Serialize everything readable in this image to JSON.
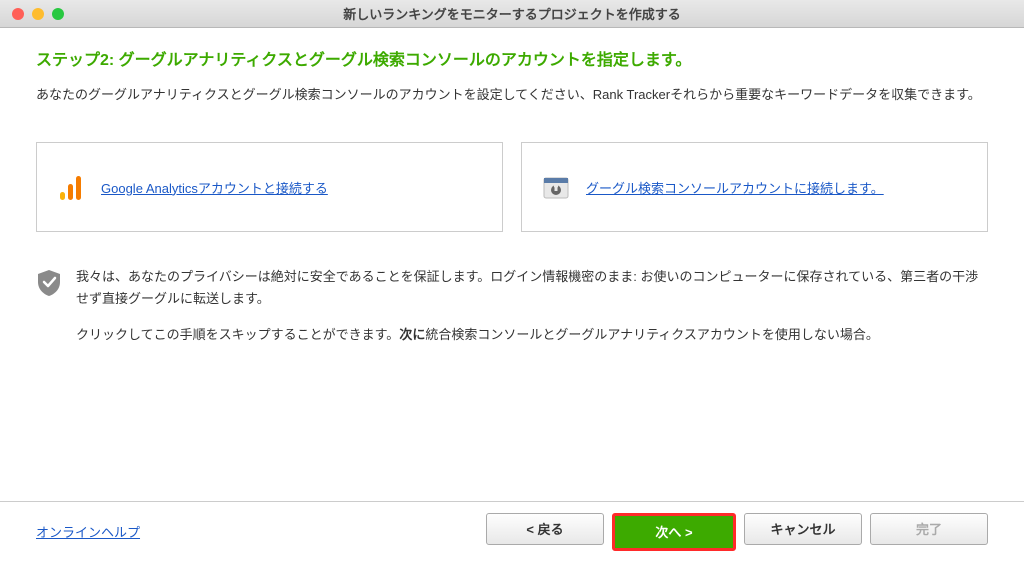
{
  "window": {
    "title": "新しいランキングをモニターするプロジェクトを作成する"
  },
  "step": {
    "heading": "ステップ2: グーグルアナリティクスとグーグル検索コンソールのアカウントを指定します。",
    "description": "あなたのグーグルアナリティクスとグーグル検索コンソールのアカウントを設定してください、Rank Trackerそれらから重要なキーワードデータを収集できます。"
  },
  "cards": {
    "analytics": {
      "label": "Google Analyticsアカウントと接続する"
    },
    "search_console": {
      "label": "グーグル検索コンソールアカウントに接続します。"
    }
  },
  "privacy": {
    "line1": "我々は、あなたのプライバシーは絶対に安全であることを保証します。ログイン情報機密のまま: お使いのコンピューターに保存されている、第三者の干渉せず直接グーグルに転送します。",
    "line2_a": "クリックしてこの手順をスキップすることができます。",
    "line2_b": "次に",
    "line2_c": "統合検索コンソールとグーグルアナリティクスアカウントを使用しない場合。"
  },
  "footer": {
    "help": "オンラインヘルプ",
    "back": "< 戻る",
    "next": "次へ >",
    "cancel": "キャンセル",
    "finish": "完了"
  }
}
